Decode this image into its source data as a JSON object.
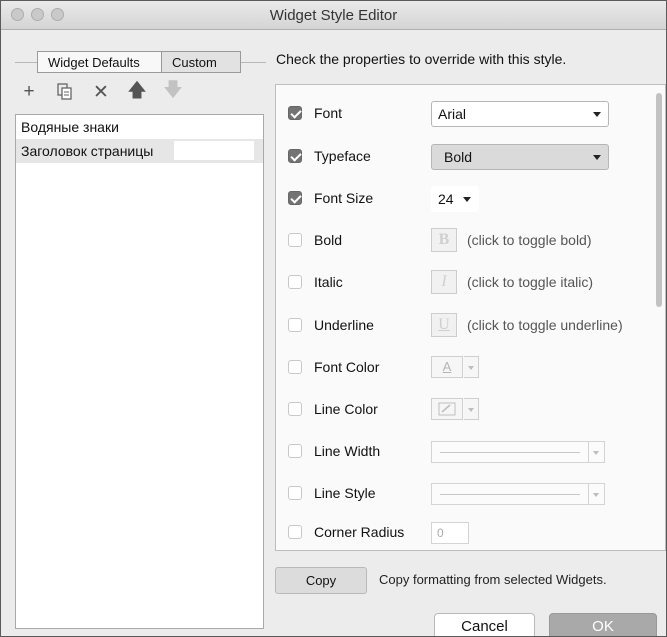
{
  "window": {
    "title": "Widget Style Editor"
  },
  "tabs": [
    {
      "label": "Widget Defaults",
      "active": false
    },
    {
      "label": "Custom",
      "active": true
    }
  ],
  "toolbar": {
    "icons": [
      "plus-icon",
      "duplicate-icon",
      "delete-icon",
      "move-up-icon",
      "move-down-icon"
    ]
  },
  "style_list": [
    {
      "label": "Водяные знаки"
    },
    {
      "label": "Заголовок страницы"
    }
  ],
  "instructions": "Check the properties to override with this style.",
  "properties": {
    "font": {
      "label": "Font",
      "checked": true,
      "value": "Arial"
    },
    "typeface": {
      "label": "Typeface",
      "checked": true,
      "value": "Bold"
    },
    "font_size": {
      "label": "Font Size",
      "checked": true,
      "value": "24"
    },
    "bold": {
      "label": "Bold",
      "checked": false,
      "glyph": "B",
      "hint": "(click to toggle bold)"
    },
    "italic": {
      "label": "Italic",
      "checked": false,
      "glyph": "I",
      "hint": "(click to toggle italic)"
    },
    "underline": {
      "label": "Underline",
      "checked": false,
      "glyph": "U",
      "hint": "(click to toggle underline)"
    },
    "font_color": {
      "label": "Font Color",
      "checked": false,
      "glyph": "A"
    },
    "line_color": {
      "label": "Line Color",
      "checked": false
    },
    "line_width": {
      "label": "Line Width",
      "checked": false
    },
    "line_style": {
      "label": "Line Style",
      "checked": false
    },
    "corner_radius": {
      "label": "Corner Radius",
      "checked": false,
      "value": "0"
    }
  },
  "copy": {
    "button_label": "Copy",
    "hint": "Copy formatting from selected Widgets."
  },
  "footer": {
    "cancel_label": "Cancel",
    "ok_label": "OK"
  }
}
